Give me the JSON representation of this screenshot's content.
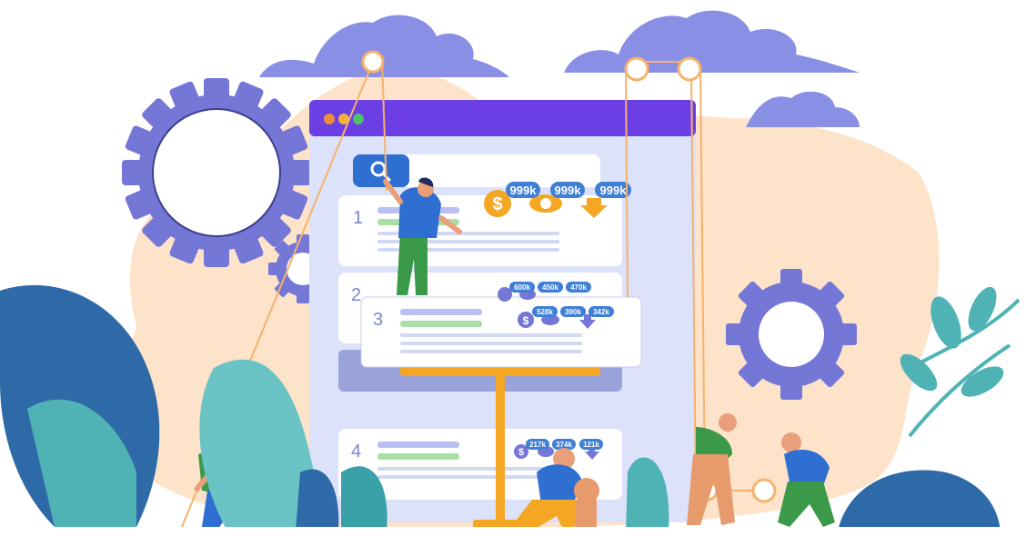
{
  "illustration": {
    "subject": "",
    "colors": {
      "background_blob": "#fde3c9",
      "browser_frame": "#6b3fe3",
      "browser_body": "#dde2fb",
      "search_button": "#2e6fd1",
      "gear": "#7577d6",
      "cloud": "#8a8fe6",
      "leaf_teal": "#4fb3b6",
      "leaf_navy": "#2f6aa8",
      "coin": "#f5a623",
      "badge": "#3f7fd6",
      "rope": "#f6b26b"
    }
  },
  "browser": {
    "dots": [
      "#f08d3c",
      "#f5b23a",
      "#4cc36b"
    ],
    "search_icon": "magnifier-icon"
  },
  "results": [
    {
      "rank": "1",
      "metrics": [
        "999k",
        "999k",
        "999k"
      ]
    },
    {
      "rank": "2",
      "metrics": [
        "600k",
        "450k",
        "470k"
      ]
    },
    {
      "rank": "3",
      "metrics": [
        "528k",
        "390k",
        "342k"
      ]
    },
    {
      "rank": "4",
      "metrics": [
        "217k",
        "374k",
        "121k"
      ]
    }
  ],
  "metric_icons": [
    "dollar-icon",
    "eye-icon",
    "arrow-down-icon"
  ]
}
